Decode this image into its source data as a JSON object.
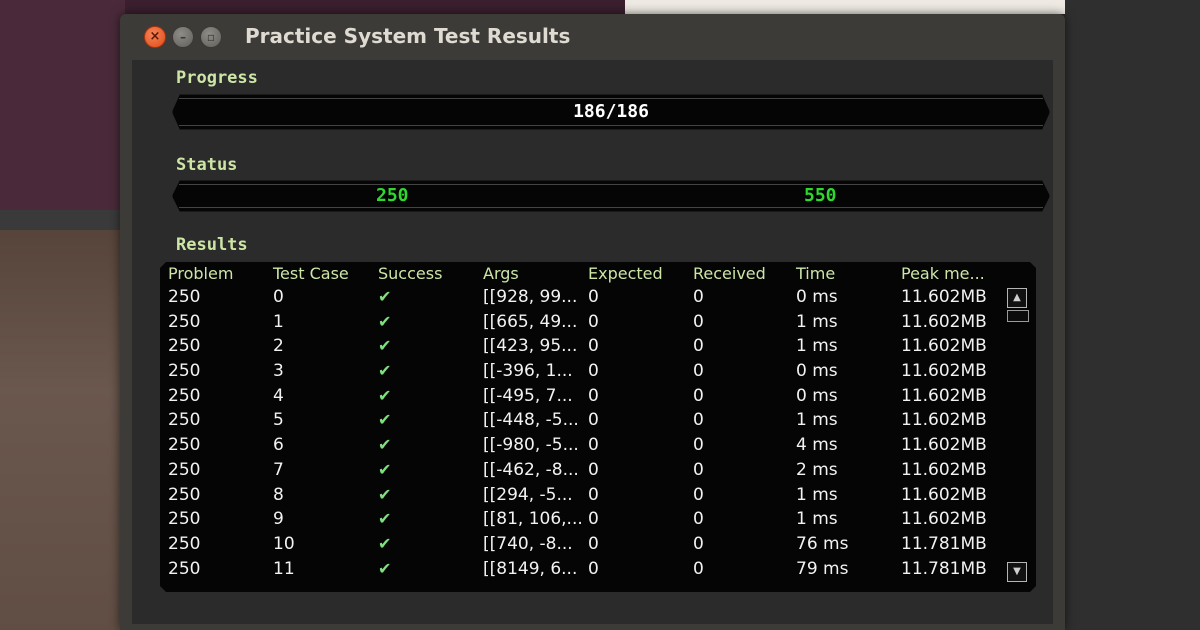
{
  "window": {
    "title": "Practice System Test Results",
    "controls": [
      "close-icon",
      "minimize-icon",
      "maximize-icon"
    ]
  },
  "progress": {
    "label": "Progress",
    "text": "186/186",
    "value": 1.0
  },
  "status": {
    "label": "Status",
    "values": [
      "250",
      "550"
    ]
  },
  "results": {
    "label": "Results",
    "columns": [
      "Problem",
      "Test Case",
      "Success",
      "Args",
      "Expected",
      "Received",
      "Time",
      "Peak me..."
    ],
    "rows": [
      {
        "problem": "250",
        "test_case": "0",
        "success": "✔",
        "args": "[[928, 99...",
        "expected": "0",
        "received": "0",
        "time": "0 ms",
        "peak": "11.602MB"
      },
      {
        "problem": "250",
        "test_case": "1",
        "success": "✔",
        "args": "[[665, 49...",
        "expected": "0",
        "received": "0",
        "time": "1 ms",
        "peak": "11.602MB"
      },
      {
        "problem": "250",
        "test_case": "2",
        "success": "✔",
        "args": "[[423, 95...",
        "expected": "0",
        "received": "0",
        "time": "1 ms",
        "peak": "11.602MB"
      },
      {
        "problem": "250",
        "test_case": "3",
        "success": "✔",
        "args": "[[-396, 1...",
        "expected": "0",
        "received": "0",
        "time": "0 ms",
        "peak": "11.602MB"
      },
      {
        "problem": "250",
        "test_case": "4",
        "success": "✔",
        "args": "[[-495, 7...",
        "expected": "0",
        "received": "0",
        "time": "0 ms",
        "peak": "11.602MB"
      },
      {
        "problem": "250",
        "test_case": "5",
        "success": "✔",
        "args": "[[-448, -5...",
        "expected": "0",
        "received": "0",
        "time": "1 ms",
        "peak": "11.602MB"
      },
      {
        "problem": "250",
        "test_case": "6",
        "success": "✔",
        "args": "[[-980, -5...",
        "expected": "0",
        "received": "0",
        "time": "4 ms",
        "peak": "11.602MB"
      },
      {
        "problem": "250",
        "test_case": "7",
        "success": "✔",
        "args": "[[-462, -8...",
        "expected": "0",
        "received": "0",
        "time": "2 ms",
        "peak": "11.602MB"
      },
      {
        "problem": "250",
        "test_case": "8",
        "success": "✔",
        "args": "[[294, -5...",
        "expected": "0",
        "received": "0",
        "time": "1 ms",
        "peak": "11.602MB"
      },
      {
        "problem": "250",
        "test_case": "9",
        "success": "✔",
        "args": "[[81, 106,...",
        "expected": "0",
        "received": "0",
        "time": "1 ms",
        "peak": "11.602MB"
      },
      {
        "problem": "250",
        "test_case": "10",
        "success": "✔",
        "args": "[[740, -8...",
        "expected": "0",
        "received": "0",
        "time": "76 ms",
        "peak": "11.781MB"
      },
      {
        "problem": "250",
        "test_case": "11",
        "success": "✔",
        "args": "[[8149, 6...",
        "expected": "0",
        "received": "0",
        "time": "79 ms",
        "peak": "11.781MB"
      }
    ]
  },
  "colors": {
    "label_green": "#cde6a6",
    "status_green": "#2fd82f",
    "check_green": "#7fe07f",
    "window_bg": "#3c3b37",
    "close_orange": "#df4a16"
  },
  "icons": {
    "scroll_up": "scroll-up-arrow-icon",
    "scroll_down": "scroll-down-arrow-icon",
    "success": "checkmark-icon"
  }
}
